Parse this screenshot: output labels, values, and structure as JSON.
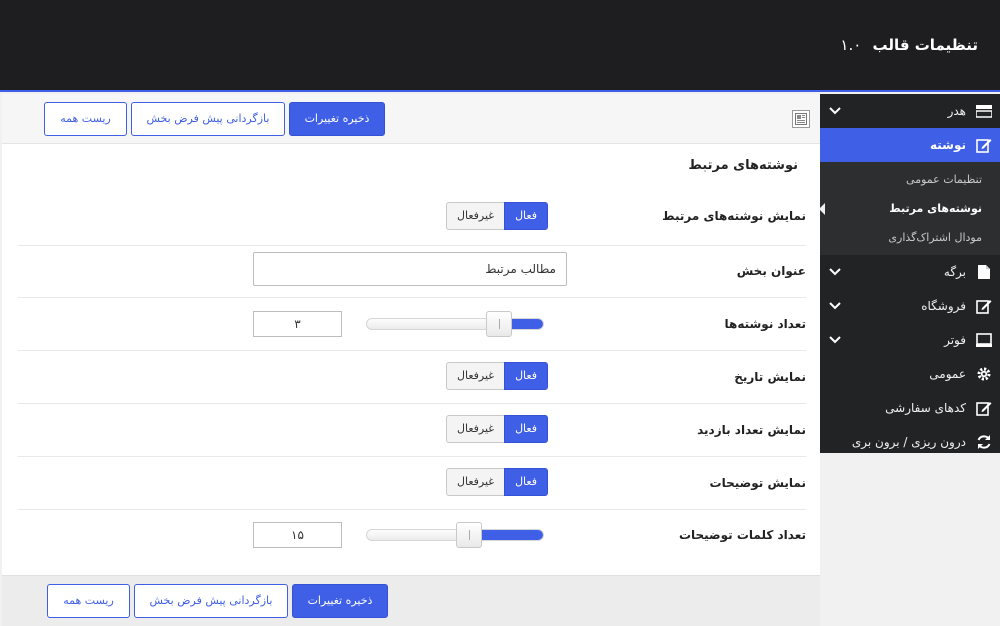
{
  "app": {
    "title": "تنظیمات قالب",
    "version": "۱.۰"
  },
  "sidebar": {
    "items": [
      {
        "label": "هدر",
        "icon": "header-icon",
        "expandable": true
      },
      {
        "label": "نوشته",
        "icon": "post-edit-icon",
        "active": true,
        "children": [
          {
            "label": "تنظیمات عمومی"
          },
          {
            "label": "نوشته‌های مرتبط",
            "current": true
          },
          {
            "label": "مودال اشتراک‌گذاری"
          }
        ]
      },
      {
        "label": "برگه",
        "icon": "page-icon",
        "expandable": true
      },
      {
        "label": "فروشگاه",
        "icon": "shop-edit-icon",
        "expandable": true
      },
      {
        "label": "فوتر",
        "icon": "footer-icon",
        "expandable": true
      },
      {
        "label": "عمومی",
        "icon": "gear-icon"
      },
      {
        "label": "کدهای سفارشی",
        "icon": "code-edit-icon"
      },
      {
        "label": "درون ریزی / برون بری",
        "icon": "sync-icon"
      }
    ]
  },
  "toolbar": {
    "save_label": "ذخیره تغییرات",
    "reset_section_label": "بازگردانی پیش فرض بخش",
    "reset_all_label": "ریست همه"
  },
  "section": {
    "title": "نوشته‌های مرتبط"
  },
  "fields": {
    "show_related": {
      "label": "نمایش نوشته‌های مرتبط",
      "on_label": "فعال",
      "off_label": "غیرفعال",
      "value": "on"
    },
    "section_title": {
      "label": "عنوان بخش",
      "value": "مطالب مرتبط"
    },
    "posts_count": {
      "label": "تعداد نوشته‌ها",
      "value": "۳",
      "slider_fraction": 0.25
    },
    "show_date": {
      "label": "نمایش تاریخ",
      "on_label": "فعال",
      "off_label": "غیرفعال",
      "value": "on"
    },
    "show_views": {
      "label": "نمایش تعداد بازدید",
      "on_label": "فعال",
      "off_label": "غیرفعال",
      "value": "on"
    },
    "show_excerpt": {
      "label": "نمایش توضیحات",
      "on_label": "فعال",
      "off_label": "غیرفعال",
      "value": "on"
    },
    "excerpt_words": {
      "label": "تعداد کلمات توضیحات",
      "value": "۱۵",
      "slider_fraction": 0.42
    }
  },
  "colors": {
    "accent": "#3f5fe6",
    "topbar": "#1e1e20",
    "sidebar": "#222325",
    "subnav": "#2d2e30"
  }
}
